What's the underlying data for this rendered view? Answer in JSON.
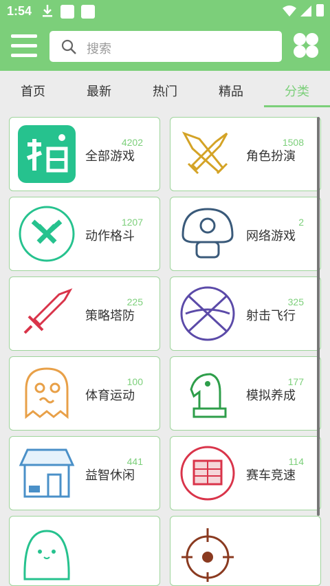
{
  "status_bar": {
    "time": "1:54"
  },
  "search": {
    "placeholder": "搜索"
  },
  "tabs": [
    {
      "label": "首页"
    },
    {
      "label": "最新"
    },
    {
      "label": "热门"
    },
    {
      "label": "精品"
    },
    {
      "label": "分类",
      "active": true
    }
  ],
  "categories": [
    {
      "name": "全部游戏",
      "count": "4202",
      "icon": "all-games-icon"
    },
    {
      "name": "角色扮演",
      "count": "1508",
      "icon": "crossed-swords-icon"
    },
    {
      "name": "动作格斗",
      "count": "1207",
      "icon": "action-swords-icon"
    },
    {
      "name": "网络游戏",
      "count": "2",
      "icon": "mushroom-icon"
    },
    {
      "name": "策略塔防",
      "count": "225",
      "icon": "sword-icon"
    },
    {
      "name": "射击飞行",
      "count": "325",
      "icon": "basketball-icon"
    },
    {
      "name": "体育运动",
      "count": "100",
      "icon": "ghost-icon"
    },
    {
      "name": "模拟养成",
      "count": "177",
      "icon": "chess-knight-icon"
    },
    {
      "name": "益智休闲",
      "count": "441",
      "icon": "shop-icon"
    },
    {
      "name": "赛车竞速",
      "count": "114",
      "icon": "castle-icon"
    },
    {
      "name": "",
      "count": "",
      "icon": "blob-face-icon"
    },
    {
      "name": "",
      "count": "",
      "icon": "target-icon"
    }
  ],
  "colors": {
    "accent": "#7ccf7a",
    "teal": "#26c28e"
  }
}
